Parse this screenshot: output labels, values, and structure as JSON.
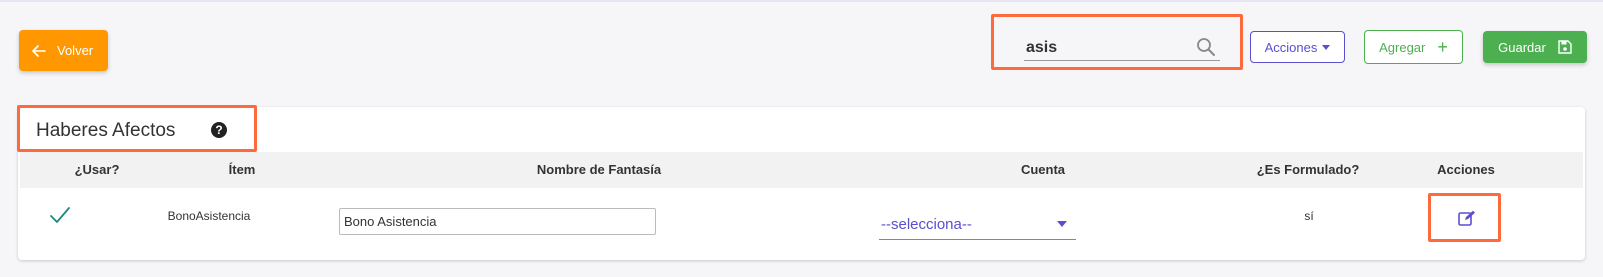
{
  "toolbar": {
    "back_label": "Volver",
    "search_value": "asis",
    "actions_label": "Acciones",
    "add_label": "Agregar",
    "save_label": "Guardar"
  },
  "card": {
    "title": "Haberes Afectos",
    "help_glyph": "?"
  },
  "table": {
    "columns": [
      "¿Usar?",
      "Ítem",
      "Nombre de Fantasía",
      "Cuenta",
      "¿Es Formulado?",
      "Acciones"
    ],
    "rows": [
      {
        "usar": "checked",
        "item": "BonoAsistencia",
        "nombre_fantasia": "Bono Asistencia",
        "cuenta": "--selecciona--",
        "es_formulado": "sí"
      }
    ]
  },
  "colors": {
    "back_button": "#ff9800",
    "primary": "#5a4fcf",
    "success": "#4caf50",
    "highlight": "#ff6a3d"
  },
  "icons": [
    "arrow-left-icon",
    "search-icon",
    "caret-down-icon",
    "plus-icon",
    "save-icon",
    "help-icon",
    "check-icon",
    "edit-icon"
  ]
}
